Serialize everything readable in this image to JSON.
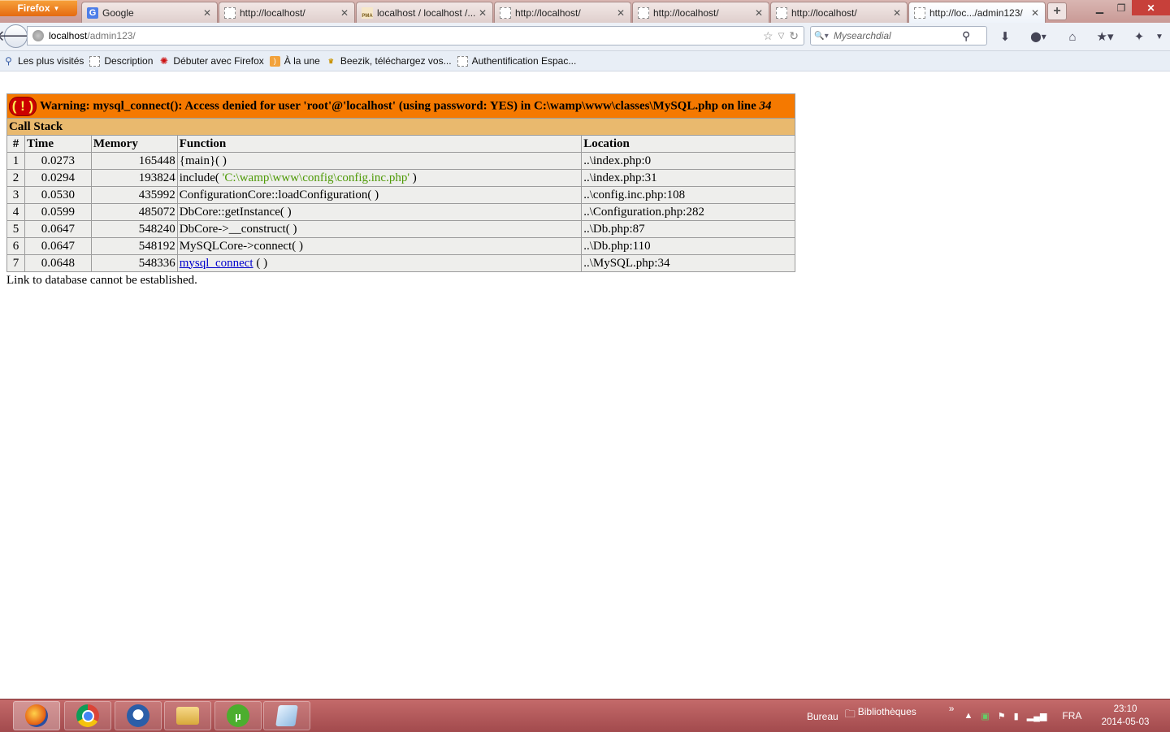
{
  "browser": {
    "menu_button": "Firefox",
    "tabs": [
      {
        "favicon": "google-icon",
        "title": "Google",
        "active": false
      },
      {
        "favicon": "blank-page-icon",
        "title": "http://localhost/",
        "active": false
      },
      {
        "favicon": "phpmyadmin-icon",
        "title": "localhost / localhost /...",
        "active": false
      },
      {
        "favicon": "blank-page-icon",
        "title": "http://localhost/",
        "active": false
      },
      {
        "favicon": "blank-page-icon",
        "title": "http://localhost/",
        "active": false
      },
      {
        "favicon": "blank-page-icon",
        "title": "http://localhost/",
        "active": false
      },
      {
        "favicon": "blank-page-icon",
        "title": "http://loc.../admin123/",
        "active": true
      }
    ],
    "new_tab_label": "+",
    "url_host": "localhost",
    "url_path": "/admin123/",
    "search_placeholder": "Mysearchdial",
    "pma_favicon_text": "PMA",
    "google_favicon_text": "G"
  },
  "bookmarks": [
    {
      "icon": "search-icon",
      "label": "Les plus visités"
    },
    {
      "icon": "blank-page-icon",
      "label": "Description"
    },
    {
      "icon": "firefox-red-icon",
      "label": "Débuter avec Firefox"
    },
    {
      "icon": "rss-icon",
      "label": "À la une"
    },
    {
      "icon": "zik-icon",
      "label": "Beezik, téléchargez vos..."
    },
    {
      "icon": "blank-page-icon",
      "label": "Authentification Espac..."
    }
  ],
  "page": {
    "warning": {
      "icon_text": "( ! )",
      "text": "Warning: mysql_connect(): Access denied for user 'root'@'localhost' (using password: YES) in C:\\wamp\\www\\classes\\MySQL.php on line ",
      "line": "34"
    },
    "call_stack_title": "Call Stack",
    "columns": [
      "#",
      "Time",
      "Memory",
      "Function",
      "Location"
    ],
    "rows": [
      {
        "n": "1",
        "time": "0.0273",
        "memory": "165448",
        "function": "{main}( )",
        "location": "..\\index.php:0"
      },
      {
        "n": "2",
        "time": "0.0294",
        "memory": "193824",
        "function_pre": "include( ",
        "function_arg": "'C:\\wamp\\www\\config\\config.inc.php'",
        "function_post": " )",
        "location": "..\\index.php:31"
      },
      {
        "n": "3",
        "time": "0.0530",
        "memory": "435992",
        "function": "ConfigurationCore::loadConfiguration( )",
        "location": "..\\config.inc.php:108"
      },
      {
        "n": "4",
        "time": "0.0599",
        "memory": "485072",
        "function": "DbCore::getInstance( )",
        "location": "..\\Configuration.php:282"
      },
      {
        "n": "5",
        "time": "0.0647",
        "memory": "548240",
        "function": "DbCore->__construct( )",
        "location": "..\\Db.php:87"
      },
      {
        "n": "6",
        "time": "0.0647",
        "memory": "548192",
        "function": "MySQLCore->connect( )",
        "location": "..\\Db.php:110"
      },
      {
        "n": "7",
        "time": "0.0648",
        "memory": "548336",
        "function_link": "mysql_connect",
        "function_post": " ( )",
        "location": "..\\MySQL.php:34"
      }
    ],
    "db_error": "Link to database cannot be established."
  },
  "taskbar": {
    "apps": [
      "firefox-icon",
      "chrome-icon",
      "thunderbird-icon",
      "file-explorer-icon",
      "utorrent-icon",
      "notepad-icon"
    ],
    "utorrent_glyph": "µ",
    "toolbar_desktop": "Bureau",
    "toolbar_libraries": "Bibliothèques",
    "overflow": "»",
    "language": "FRA",
    "time": "23:10",
    "date": "2014-05-03"
  }
}
